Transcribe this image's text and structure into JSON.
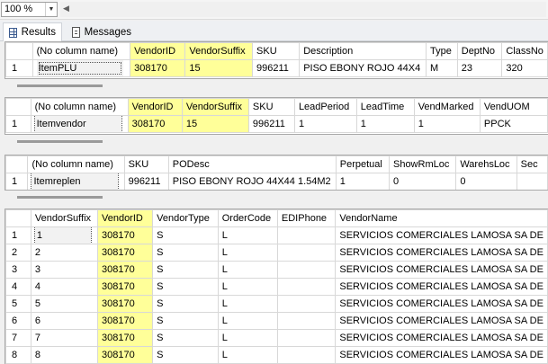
{
  "zoom": {
    "value": "100 %"
  },
  "tabs": [
    {
      "label": "Results",
      "icon": "grid-icon"
    },
    {
      "label": "Messages",
      "icon": "messages-icon"
    }
  ],
  "result1": {
    "columns": [
      "(No column name)",
      "VendorID",
      "VendorSuffix",
      "SKU",
      "Description",
      "Type",
      "DeptNo",
      "ClassNo"
    ],
    "rows": [
      [
        "1",
        "ItemPLU",
        "308170",
        "15",
        "996211",
        "PISO EBONY ROJO 44X4",
        "M",
        "23",
        "320"
      ]
    ]
  },
  "result2": {
    "columns": [
      "(No column name)",
      "VendorID",
      "VendorSuffix",
      "SKU",
      "LeadPeriod",
      "LeadTime",
      "VendMarked",
      "VendUOM"
    ],
    "rows": [
      [
        "1",
        "Itemvendor",
        "308170",
        "15",
        "996211",
        "1",
        "1",
        "1",
        "PPCK"
      ]
    ]
  },
  "result3": {
    "columns": [
      "(No column name)",
      "SKU",
      "PODesc",
      "Perpetual",
      "ShowRmLoc",
      "WarehsLoc",
      "Sec"
    ],
    "rows": [
      [
        "1",
        "Itemreplen",
        "996211",
        "PISO EBONY ROJO 44X44 1.54M2",
        "1",
        "0",
        "0",
        ""
      ]
    ]
  },
  "result4": {
    "columns": [
      "VendorSuffix",
      "VendorID",
      "VendorType",
      "OrderCode",
      "EDIPhone",
      "VendorName"
    ],
    "rows": [
      [
        "1",
        "1",
        "308170",
        "S",
        "L",
        "",
        "SERVICIOS COMERCIALES LAMOSA SA DE"
      ],
      [
        "2",
        "2",
        "308170",
        "S",
        "L",
        "",
        "SERVICIOS COMERCIALES LAMOSA SA DE"
      ],
      [
        "3",
        "3",
        "308170",
        "S",
        "L",
        "",
        "SERVICIOS COMERCIALES LAMOSA SA DE"
      ],
      [
        "4",
        "4",
        "308170",
        "S",
        "L",
        "",
        "SERVICIOS COMERCIALES LAMOSA SA DE"
      ],
      [
        "5",
        "5",
        "308170",
        "S",
        "L",
        "",
        "SERVICIOS COMERCIALES LAMOSA SA DE"
      ],
      [
        "6",
        "6",
        "308170",
        "S",
        "L",
        "",
        "SERVICIOS COMERCIALES LAMOSA SA DE"
      ],
      [
        "7",
        "7",
        "308170",
        "S",
        "L",
        "",
        "SERVICIOS COMERCIALES LAMOSA SA DE"
      ],
      [
        "8",
        "8",
        "308170",
        "S",
        "L",
        "",
        "SERVICIOS COMERCIALES LAMOSA SA DE"
      ]
    ]
  },
  "colors": {
    "highlight": "#ffff99",
    "grid_border": "#d8d8d8"
  }
}
